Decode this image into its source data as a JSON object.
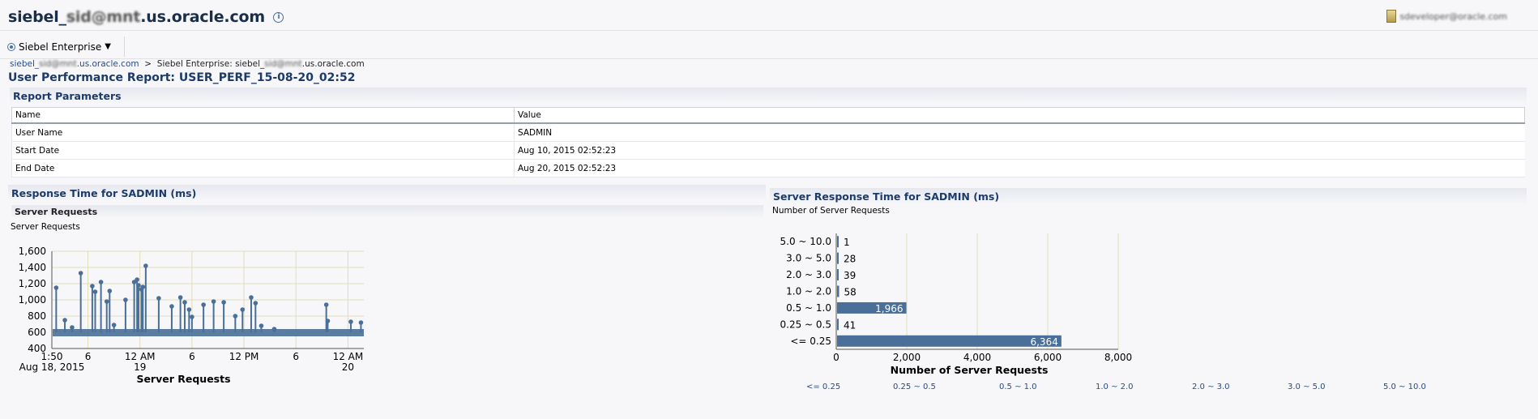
{
  "header": {
    "title_prefix": "siebel_",
    "title_blurred": "sid@mnt",
    "title_suffix": ".us.oracle.com",
    "info_icon": "info-icon",
    "user_blurred": "sdeveloper@oracle.com",
    "doc_icon": "document-icon"
  },
  "nav": {
    "label": "Siebel Enterprise",
    "icon": "radio-icon"
  },
  "breadcrumb": {
    "link_prefix": "siebel_",
    "link_blurred": "sid@mnt",
    "link_suffix": ".us.oracle.com",
    "separator": ">",
    "current_prefix": "Siebel Enterprise: siebel_",
    "current_blurred": "sid@mnt",
    "current_suffix": ".us.oracle.com"
  },
  "report": {
    "title": "User Performance Report: USER_PERF_15-08-20_02:52"
  },
  "parameters": {
    "title": "Report Parameters",
    "columns": [
      "Name",
      "Value"
    ],
    "rows": [
      [
        "User Name",
        "SADMIN"
      ],
      [
        "Start Date",
        "Aug 10, 2015 02:52:23"
      ],
      [
        "End Date",
        "Aug 20, 2015 02:52:23"
      ]
    ]
  },
  "left_panel": {
    "title": "Response Time for SADMIN (ms)",
    "subtitle": "Server Requests",
    "series_label": "Server Requests"
  },
  "right_panel": {
    "title": "Server Response Time for SADMIN (ms)",
    "series_label": "Number of Server Requests"
  },
  "colors": {
    "series": "#4a6f98",
    "title": "#1c3b6b",
    "link": "#254d87",
    "grid": "#e0dcb8"
  },
  "chart_data": [
    {
      "type": "line",
      "title": "Server Requests",
      "xlabel": "Server Requests",
      "ylabel": "",
      "ylim": [
        400,
        1600
      ],
      "y_ticks": [
        "1,600",
        "1,400",
        "1,200",
        "1,000",
        "800",
        "600",
        "400"
      ],
      "y_tick_values": [
        1600,
        1400,
        1200,
        1000,
        800,
        600,
        400
      ],
      "x_range": [
        "2015-08-18T13:50",
        "2015-08-20T01:50"
      ],
      "x_tick_labels": [
        {
          "label": "1:50",
          "sub": "Aug 18, 2015",
          "t": "2015-08-18T13:50"
        },
        {
          "label": "6",
          "sub": "",
          "t": "2015-08-18T18:00"
        },
        {
          "label": "12 AM",
          "sub": "19",
          "t": "2015-08-19T00:00"
        },
        {
          "label": "6",
          "sub": "",
          "t": "2015-08-19T06:00"
        },
        {
          "label": "12 PM",
          "sub": "",
          "t": "2015-08-19T12:00"
        },
        {
          "label": "6",
          "sub": "",
          "t": "2015-08-19T18:00"
        },
        {
          "label": "12 AM",
          "sub": "20",
          "t": "2015-08-20T00:00"
        }
      ],
      "baseline": 600,
      "points": [
        {
          "t": "2015-08-18T14:20",
          "v": 1150
        },
        {
          "t": "2015-08-18T15:20",
          "v": 750
        },
        {
          "t": "2015-08-18T16:10",
          "v": 660
        },
        {
          "t": "2015-08-18T17:10",
          "v": 1330
        },
        {
          "t": "2015-08-18T18:30",
          "v": 1170
        },
        {
          "t": "2015-08-18T18:50",
          "v": 1100
        },
        {
          "t": "2015-08-18T19:30",
          "v": 1220
        },
        {
          "t": "2015-08-18T20:10",
          "v": 980
        },
        {
          "t": "2015-08-18T20:30",
          "v": 1110
        },
        {
          "t": "2015-08-18T21:00",
          "v": 690
        },
        {
          "t": "2015-08-18T22:20",
          "v": 1000
        },
        {
          "t": "2015-08-18T23:20",
          "v": 1220
        },
        {
          "t": "2015-08-18T23:40",
          "v": 1250
        },
        {
          "t": "2015-08-18T23:50",
          "v": 1180
        },
        {
          "t": "2015-08-19T00:10",
          "v": 1130
        },
        {
          "t": "2015-08-19T00:20",
          "v": 1160
        },
        {
          "t": "2015-08-19T00:40",
          "v": 1420
        },
        {
          "t": "2015-08-19T02:10",
          "v": 1020
        },
        {
          "t": "2015-08-19T03:40",
          "v": 920
        },
        {
          "t": "2015-08-19T04:40",
          "v": 1030
        },
        {
          "t": "2015-08-19T05:10",
          "v": 970
        },
        {
          "t": "2015-08-19T05:40",
          "v": 880
        },
        {
          "t": "2015-08-19T06:00",
          "v": 790
        },
        {
          "t": "2015-08-19T07:20",
          "v": 940
        },
        {
          "t": "2015-08-19T08:30",
          "v": 980
        },
        {
          "t": "2015-08-19T09:40",
          "v": 970
        },
        {
          "t": "2015-08-19T11:00",
          "v": 800
        },
        {
          "t": "2015-08-19T11:50",
          "v": 880
        },
        {
          "t": "2015-08-19T12:50",
          "v": 1030
        },
        {
          "t": "2015-08-19T13:20",
          "v": 960
        },
        {
          "t": "2015-08-19T14:00",
          "v": 680
        },
        {
          "t": "2015-08-19T15:30",
          "v": 640
        },
        {
          "t": "2015-08-19T21:30",
          "v": 940
        },
        {
          "t": "2015-08-19T21:40",
          "v": 740
        },
        {
          "t": "2015-08-20T00:20",
          "v": 730
        },
        {
          "t": "2015-08-20T01:30",
          "v": 720
        }
      ]
    },
    {
      "type": "bar",
      "orientation": "horizontal",
      "title": "Number of Server Requests",
      "xlabel": "Number of Server Requests",
      "ylabel": "",
      "xlim": [
        0,
        8000
      ],
      "x_ticks": [
        "0",
        "2,000",
        "4,000",
        "6,000",
        "8,000"
      ],
      "x_tick_values": [
        0,
        2000,
        4000,
        6000,
        8000
      ],
      "categories": [
        "5.0 ~ 10.0",
        "3.0 ~ 5.0",
        "2.0 ~ 3.0",
        "1.0 ~ 2.0",
        "0.5 ~ 1.0",
        "0.25 ~ 0.5",
        "<= 0.25"
      ],
      "values": [
        1,
        28,
        39,
        58,
        1966,
        41,
        6364
      ],
      "labels": [
        "1",
        "28",
        "39",
        "58",
        "1,966",
        "41",
        "6,364"
      ],
      "legend": [
        "<= 0.25",
        "0.25 ~ 0.5",
        "0.5 ~ 1.0",
        "1.0 ~ 2.0",
        "2.0 ~ 3.0",
        "3.0 ~ 5.0",
        "5.0 ~ 10.0"
      ]
    }
  ]
}
